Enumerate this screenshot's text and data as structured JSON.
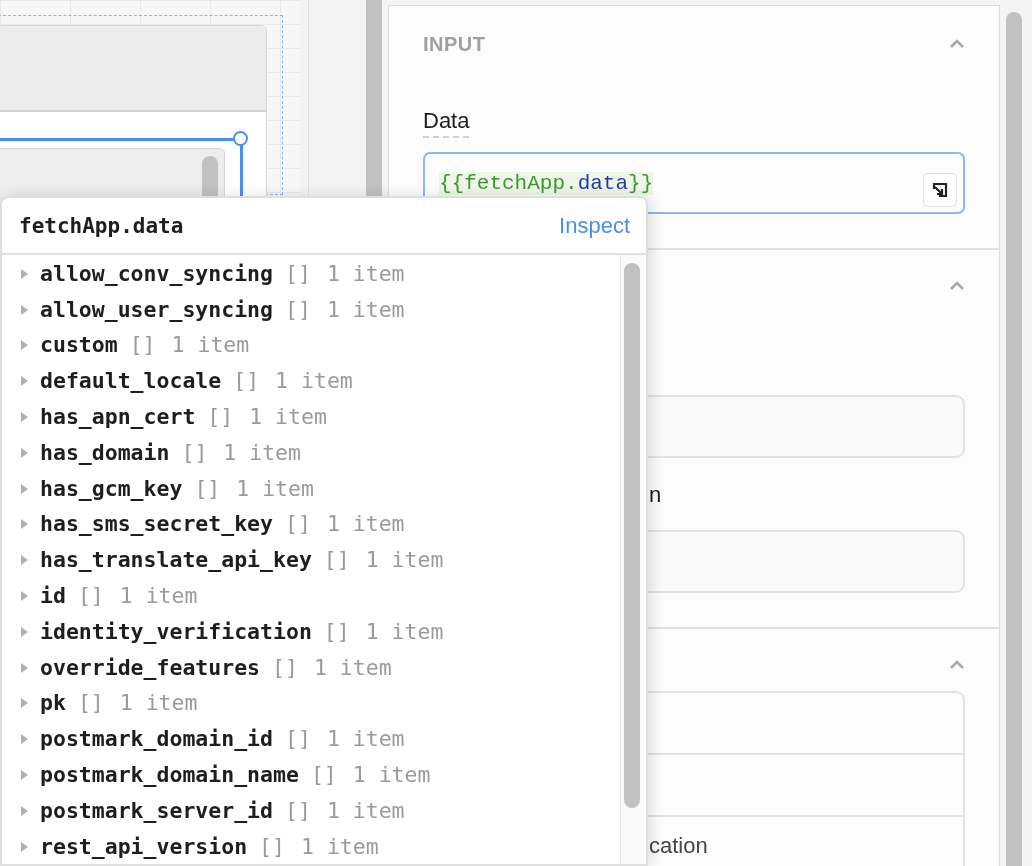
{
  "inspector": {
    "sections": [
      {
        "title": "INPUT",
        "expanded": true,
        "items": [
          {
            "kind": "label",
            "text": "Data"
          },
          {
            "kind": "code",
            "value": "{{fetchApp.data}}"
          }
        ]
      },
      {
        "expanded": true,
        "items": [
          {
            "kind": "field"
          },
          {
            "kind": "label",
            "text": "n"
          },
          {
            "kind": "field"
          }
        ]
      },
      {
        "expanded": true,
        "items": [
          {
            "kind": "list",
            "rows": [
              {
                "kind": "blank"
              },
              {
                "kind": "blank"
              },
              {
                "kind": "text",
                "text": "cation"
              }
            ]
          }
        ]
      }
    ]
  },
  "popover": {
    "title": "fetchApp.data",
    "action": "Inspect",
    "rows": [
      {
        "key": "allow_conv_syncing",
        "type": "[]",
        "count": "1 item",
        "expanded": false
      },
      {
        "key": "allow_user_syncing",
        "type": "[]",
        "count": "1 item",
        "expanded": false
      },
      {
        "key": "custom",
        "type": "[]",
        "count": "1 item",
        "expanded": false
      },
      {
        "key": "default_locale",
        "type": "[]",
        "count": "1 item",
        "expanded": false
      },
      {
        "key": "has_apn_cert",
        "type": "[]",
        "count": "1 item",
        "expanded": false
      },
      {
        "key": "has_domain",
        "type": "[]",
        "count": "1 item",
        "expanded": false
      },
      {
        "key": "has_gcm_key",
        "type": "[]",
        "count": "1 item",
        "expanded": false
      },
      {
        "key": "has_sms_secret_key",
        "type": "[]",
        "count": "1 item",
        "expanded": false
      },
      {
        "key": "has_translate_api_key",
        "type": "[]",
        "count": "1 item",
        "expanded": false
      },
      {
        "key": "id",
        "type": "[]",
        "count": "1 item",
        "expanded": false
      },
      {
        "key": "identity_verification",
        "type": "[]",
        "count": "1 item",
        "expanded": false
      },
      {
        "key": "override_features",
        "type": "[]",
        "count": "1 item",
        "expanded": false
      },
      {
        "key": "pk",
        "type": "[]",
        "count": "1 item",
        "expanded": false
      },
      {
        "key": "postmark_domain_id",
        "type": "[]",
        "count": "1 item",
        "expanded": false
      },
      {
        "key": "postmark_domain_name",
        "type": "[]",
        "count": "1 item",
        "expanded": false
      },
      {
        "key": "postmark_server_id",
        "type": "[]",
        "count": "1 item",
        "expanded": false
      },
      {
        "key": "rest_api_version",
        "type": "[]",
        "count": "1 item",
        "expanded": false
      }
    ]
  }
}
